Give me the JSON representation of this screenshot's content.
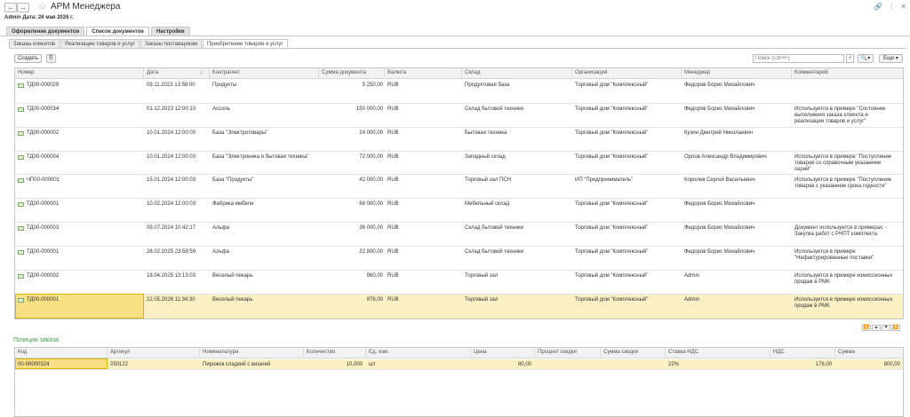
{
  "window": {
    "title": "АРМ Менеджера"
  },
  "userline": "Admin  Дата: 26 мая 2026 г.",
  "main_tabs": [
    "Оформление документов",
    "Список документов",
    "Настройки"
  ],
  "sub_tabs": [
    "Заказы клиентов",
    "Реализации товаров и услуг",
    "Заказы поставщикам",
    "Приобретение товаров и услуг"
  ],
  "toolbar": {
    "create": "Создать",
    "search_placeholder": "Поиск (Ctrl+F)",
    "more": "Еще"
  },
  "docs": {
    "columns": [
      "Номер",
      "Дата",
      "Контрагент",
      "Сумма документа",
      "Валюта",
      "Склад",
      "Организация",
      "Менеджер",
      "Комментарий"
    ],
    "sort_indicator": "↓",
    "rows": [
      {
        "num": "ТД00-000029",
        "date": "09.11.2023 13:58:00",
        "contractor": "Продукты",
        "sum": "5 250,00",
        "cur": "RUB",
        "warehouse": "Продуктовая база",
        "org": "Торговый дом \"Комплексный\"",
        "manager": "Федоров Борис Михайлович",
        "comment": ""
      },
      {
        "num": "ТД00-000034",
        "date": "01.12.2023 12:00:10",
        "contractor": "Ассоль",
        "sum": "150 000,00",
        "cur": "RUB",
        "warehouse": "Склад бытовой техники",
        "org": "Торговый дом \"Комплексный\"",
        "manager": "Федоров Борис Михайлович",
        "comment": "Используется в примере \"Состояние выполнения заказа клиента и реализации товаров и услуг\""
      },
      {
        "num": "ТД00-000002",
        "date": "10.01.2024 12:00:00",
        "contractor": "База \"Электротовары\"",
        "sum": "24 000,00",
        "cur": "RUB",
        "warehouse": "Бытовая техника",
        "org": "Торговый дом \"Комплексный\"",
        "manager": "Кузин Дмитрий Николаевич",
        "comment": ""
      },
      {
        "num": "ТД00-000004",
        "date": "10.01.2024 12:00:03",
        "contractor": "База \"Электроника и бытовая техника\"",
        "sum": "72 000,00",
        "cur": "RUB",
        "warehouse": "Западный склад",
        "org": "Торговый дом \"Комплексный\"",
        "manager": "Орлов Александр Владимирович",
        "comment": "Используется в примере \"Поступление товаров со справочным указанием серий\""
      },
      {
        "num": "ЧП00-000001",
        "date": "15.01.2024 12:00:03",
        "contractor": "База \"Продукты\"",
        "sum": "42 000,00",
        "cur": "RUB",
        "warehouse": "Торговый зал ПСН",
        "org": "ИП \"Предприниматель\"",
        "manager": "Королев Сергей Васильевич",
        "comment": "Используется в примере \"Поступление товаров с указанием срока годности\""
      },
      {
        "num": "ТД00-000001",
        "date": "10.02.2024 12:00:03",
        "contractor": "Фабрика мебели",
        "sum": "68 000,00",
        "cur": "RUB",
        "warehouse": "Мебельный склад",
        "org": "Торговый дом \"Комплексный\"",
        "manager": "Федоров Борис Михайлович",
        "comment": ""
      },
      {
        "num": "ТД00-000003",
        "date": "09.07.2024 10:42:17",
        "contractor": "Альфа",
        "sum": "36 000,00",
        "cur": "RUB",
        "warehouse": "Склад бытовой техники",
        "org": "Торговый дом \"Комплексный\"",
        "manager": "Федоров Борис Михайлович",
        "comment": "Документ используется в примерах: - Закупка работ с РНПТ комплекта"
      },
      {
        "num": "ТД00-000001",
        "date": "28.02.2025 23:59:59",
        "contractor": "Альфа",
        "sum": "22 800,00",
        "cur": "RUB",
        "warehouse": "Склад бытовой техники",
        "org": "Торговый дом \"Комплексный\"",
        "manager": "Федоров Борис Михайлович",
        "comment": "Используется в примере \"Нефактурированные поставки\""
      },
      {
        "num": "ТД00-000002",
        "date": "18.04.2025 13:13:03",
        "contractor": "Веселый пекарь",
        "sum": "960,00",
        "cur": "RUB",
        "warehouse": "Торговый зал",
        "org": "Торговый дом \"Комплексный\"",
        "manager": "Admin",
        "comment": "Используется в примере комиссионных продаж в РМК"
      },
      {
        "num": "ТД00-000001",
        "date": "22.05.2026 11:34:30",
        "contractor": "Веселый пекарь",
        "sum": "976,00",
        "cur": "RUB",
        "warehouse": "Торговый зал",
        "org": "Торговый дом \"Комплексный\"",
        "manager": "Admin",
        "comment": "Используется в примере комиссионных продаж в РМК"
      }
    ]
  },
  "positions": {
    "title": "Позиции заказа",
    "columns": [
      "Код",
      "Артикул",
      "Номенклатура",
      "Количество",
      "Ед. изм.",
      "Цена",
      "Процент скидки",
      "Сумма скидки",
      "Ставка НДС",
      "НДС",
      "Сумма"
    ],
    "rows": [
      {
        "code": "00-00000324",
        "article": "250122",
        "name": "Пирожок сладкий с вишней",
        "qty": "10,000",
        "unit": "шт",
        "price": "80,00",
        "discount_pct": "",
        "discount_sum": "",
        "vat_rate": "22%",
        "vat": "176,00",
        "sum": "800,00"
      }
    ]
  }
}
